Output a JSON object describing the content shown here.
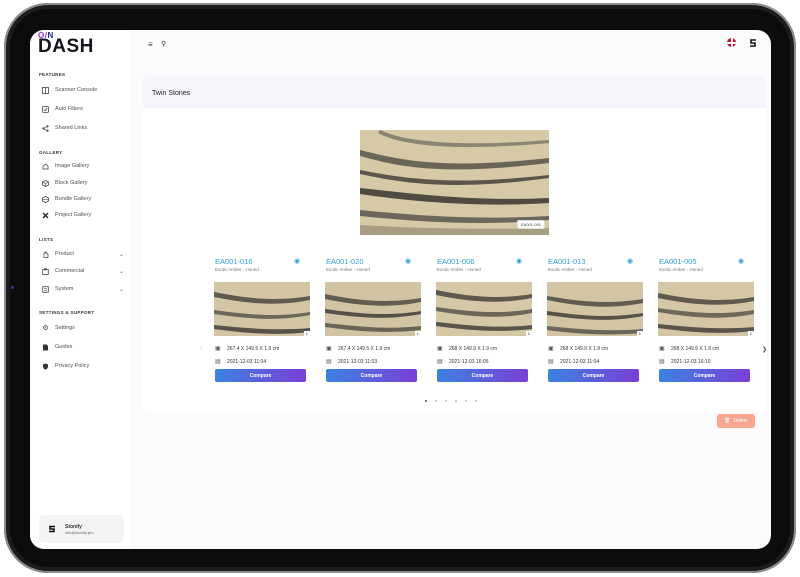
{
  "app": {
    "logo_top_left": "O",
    "logo_top_slash": "/",
    "logo_top_right": "N",
    "logo_main": "DASH"
  },
  "sidebar": {
    "sections": {
      "features": "FEATURES",
      "gallery": "GALLERY",
      "lists": "LISTS",
      "settings": "SETTINGS & SUPPORT"
    },
    "items": [
      {
        "label": "Scanner Console",
        "icon": "scanner-icon"
      },
      {
        "label": "Auto Filters",
        "icon": "filter-icon"
      },
      {
        "label": "Shared Links",
        "icon": "share-icon"
      },
      {
        "label": "Image Gallery",
        "icon": "image-icon"
      },
      {
        "label": "Block Gallery",
        "icon": "cube-icon"
      },
      {
        "label": "Bundle Gallery",
        "icon": "bundle-icon"
      },
      {
        "label": "Project Gallery",
        "icon": "project-icon"
      },
      {
        "label": "Product",
        "icon": "hand-icon"
      },
      {
        "label": "Commercial",
        "icon": "commercial-icon"
      },
      {
        "label": "System",
        "icon": "system-icon"
      },
      {
        "label": "Settings",
        "icon": "gear-icon"
      },
      {
        "label": "Guides",
        "icon": "document-icon"
      },
      {
        "label": "Privacy Policy",
        "icon": "shield-icon"
      }
    ],
    "profile": {
      "name": "Stonify",
      "email": "info@stonify.pro"
    }
  },
  "page": {
    "title": "Twin Stones",
    "hero_tag": "EA001-001",
    "delete_label": "Delete"
  },
  "cards": [
    {
      "code": "EA001-016",
      "subtitle": "Exotic Amber - Honed",
      "count": "1",
      "dims": "267.4  X  149.5  X  1.9   cm",
      "date": "2021-12-03 11:04",
      "button": "Compare"
    },
    {
      "code": "EA001-020",
      "subtitle": "Exotic Amber - Honed",
      "count": "1",
      "dims": "267.4  X  149.5  X  1.9   cm",
      "date": "2021-12-03 11:03",
      "button": "Compare"
    },
    {
      "code": "EA001-006",
      "subtitle": "Exotic Amber - Honed",
      "count": "1",
      "dims": "268  X  149.9  X  1.9   cm",
      "date": "2021-12-03 16:05",
      "button": "Compare"
    },
    {
      "code": "EA001-013",
      "subtitle": "Exotic Amber - Honed",
      "count": "1",
      "dims": "268  X  149.9  X  1.9   cm",
      "date": "2021-12-03 11:04",
      "button": "Compare"
    },
    {
      "code": "EA001-005",
      "subtitle": "Exotic Amber - Honed",
      "count": "1",
      "dims": "268  X  149.9  X  1.9   cm",
      "date": "2021-12-03 16:10",
      "button": "Compare"
    }
  ],
  "carousel": {
    "active_page": 1,
    "total_pages": 6
  },
  "colors": {
    "accent": "#2fa0d8",
    "button_start": "#3b82e0",
    "button_end": "#7b3fd6",
    "delete": "#f6a58e"
  }
}
